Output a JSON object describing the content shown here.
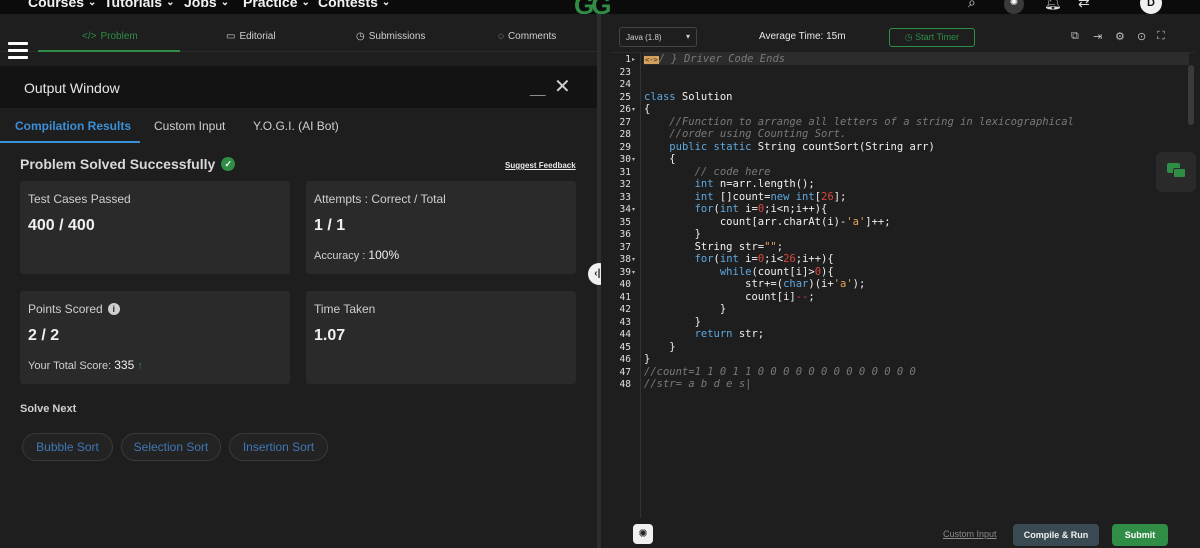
{
  "topnav": {
    "items": [
      "Courses",
      "Tutorials",
      "Jobs",
      "Practice",
      "Contests"
    ],
    "logo": "GG",
    "avatar_initial": "D"
  },
  "problem_tabs": [
    {
      "icon": "</>",
      "label": "Problem"
    },
    {
      "icon": "▭",
      "label": "Editorial"
    },
    {
      "icon": "◷",
      "label": "Submissions"
    },
    {
      "icon": "◌",
      "label": "Comments"
    }
  ],
  "output_window": {
    "title": "Output Window",
    "min_glyph": "__",
    "close_glyph": "✕",
    "tabs": [
      "Compilation Results",
      "Custom Input",
      "Y.O.G.I. (AI Bot)"
    ],
    "status": "Problem Solved Successfully",
    "suggest_feedback": "Suggest Feedback",
    "cards": {
      "test_cases": {
        "label": "Test Cases Passed",
        "value": "400 / 400"
      },
      "attempts": {
        "label": "Attempts : Correct / Total",
        "value": "1 / 1",
        "accuracy_label": "Accuracy :",
        "accuracy_value": "100%"
      },
      "points": {
        "label": "Points Scored",
        "value": "2 / 2",
        "total_label": "Your Total Score:",
        "total_value": "335"
      },
      "time": {
        "label": "Time Taken",
        "value": "1.07"
      }
    },
    "solve_next_label": "Solve Next",
    "solve_next": [
      "Bubble Sort",
      "Selection Sort",
      "Insertion Sort"
    ]
  },
  "editor": {
    "language": "Java (1.8)",
    "average_time": "Average Time: 15m",
    "start_timer": "Start Timer",
    "line_numbers": [
      "1",
      "23",
      "24",
      "25",
      "26",
      "27",
      "28",
      "29",
      "30",
      "31",
      "32",
      "33",
      "34",
      "35",
      "36",
      "37",
      "38",
      "39",
      "40",
      "41",
      "42",
      "43",
      "44",
      "45",
      "46",
      "47",
      "48"
    ]
  },
  "bottom": {
    "custom_input": "Custom Input",
    "compile_run": "Compile & Run",
    "submit": "Submit"
  }
}
